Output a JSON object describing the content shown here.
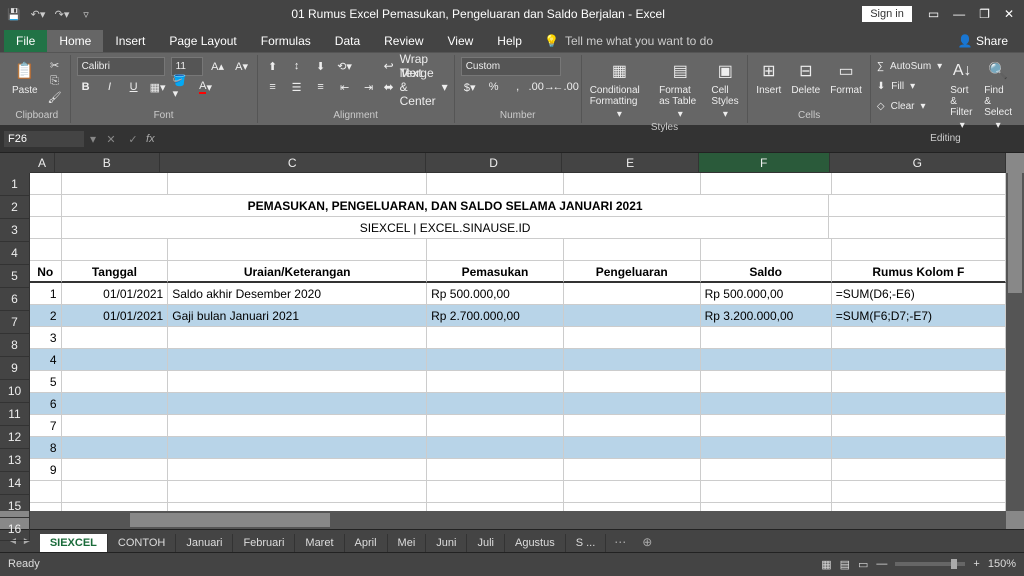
{
  "title": "01 Rumus Excel Pemasukan, Pengeluaran dan Saldo Berjalan  -  Excel",
  "signin": "Sign in",
  "tabs": {
    "file": "File",
    "home": "Home",
    "insert": "Insert",
    "pageLayout": "Page Layout",
    "formulas": "Formulas",
    "data": "Data",
    "review": "Review",
    "view": "View",
    "help": "Help",
    "tellme": "Tell me what you want to do",
    "share": "Share"
  },
  "ribbon": {
    "clipboard": {
      "paste": "Paste",
      "label": "Clipboard"
    },
    "font": {
      "name": "Calibri",
      "size": "11",
      "label": "Font"
    },
    "alignment": {
      "wrap": "Wrap Text",
      "merge": "Merge & Center",
      "label": "Alignment"
    },
    "number": {
      "format": "Custom",
      "label": "Number"
    },
    "styles": {
      "cond": "Conditional Formatting",
      "fmt": "Format as Table",
      "cell": "Cell Styles",
      "label": "Styles"
    },
    "cells": {
      "insert": "Insert",
      "delete": "Delete",
      "format": "Format",
      "label": "Cells"
    },
    "editing": {
      "autosum": "AutoSum",
      "fill": "Fill",
      "clear": "Clear",
      "sort": "Sort & Filter",
      "find": "Find & Select",
      "label": "Editing"
    }
  },
  "namebox": "F26",
  "cols": [
    "A",
    "B",
    "C",
    "D",
    "E",
    "F",
    "G"
  ],
  "sheetTitle": "PEMASUKAN, PENGELUARAN, DAN SALDO SELAMA JANUARI 2021",
  "sheetSubtitle": "SIEXCEL | EXCEL.SINAUSE.ID",
  "headers": {
    "no": "No",
    "tanggal": "Tanggal",
    "uraian": "Uraian/Keterangan",
    "pemasukan": "Pemasukan",
    "pengeluaran": "Pengeluaran",
    "saldo": "Saldo",
    "rumus": "Rumus Kolom F"
  },
  "rows": [
    {
      "no": "1",
      "tgl": "01/01/2021",
      "uraian": "Saldo akhir Desember 2020",
      "masuk": "Rp      500.000,00",
      "keluar": "",
      "saldo": "Rp    500.000,00",
      "rumus": "=SUM(D6;-E6)"
    },
    {
      "no": "2",
      "tgl": "01/01/2021",
      "uraian": "Gaji bulan Januari 2021",
      "masuk": "Rp   2.700.000,00",
      "keluar": "",
      "saldo": "Rp 3.200.000,00",
      "rumus": "=SUM(F6;D7;-E7)"
    },
    {
      "no": "3"
    },
    {
      "no": "4"
    },
    {
      "no": "5"
    },
    {
      "no": "6"
    },
    {
      "no": "7"
    },
    {
      "no": "8"
    },
    {
      "no": "9"
    }
  ],
  "sheets": [
    "SIEXCEL",
    "CONTOH",
    "Januari",
    "Februari",
    "Maret",
    "April",
    "Mei",
    "Juni",
    "Juli",
    "Agustus",
    "S ..."
  ],
  "status": {
    "ready": "Ready",
    "zoom": "150%"
  }
}
